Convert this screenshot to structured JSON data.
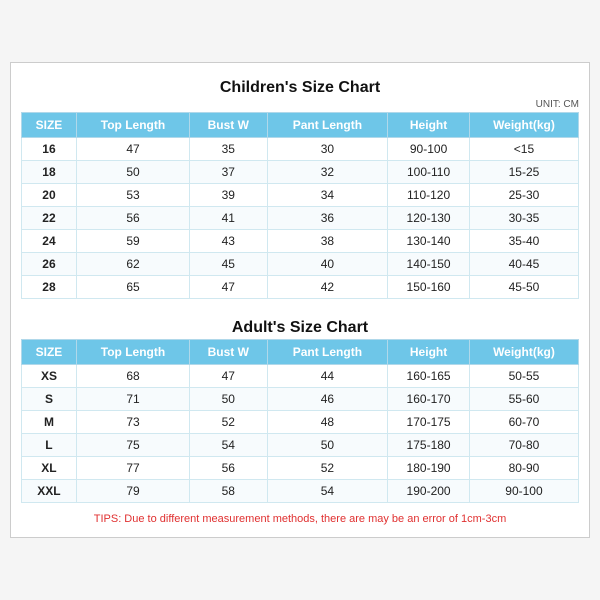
{
  "children_title": "Children's Size Chart",
  "adult_title": "Adult's Size Chart",
  "unit": "UNIT: CM",
  "tips": "TIPS: Due to different measurement methods, there are may be an error of 1cm-3cm",
  "headers": [
    "SIZE",
    "Top Length",
    "Bust W",
    "Pant Length",
    "Height",
    "Weight(kg)"
  ],
  "children_rows": [
    [
      "16",
      "47",
      "35",
      "30",
      "90-100",
      "<15"
    ],
    [
      "18",
      "50",
      "37",
      "32",
      "100-110",
      "15-25"
    ],
    [
      "20",
      "53",
      "39",
      "34",
      "110-120",
      "25-30"
    ],
    [
      "22",
      "56",
      "41",
      "36",
      "120-130",
      "30-35"
    ],
    [
      "24",
      "59",
      "43",
      "38",
      "130-140",
      "35-40"
    ],
    [
      "26",
      "62",
      "45",
      "40",
      "140-150",
      "40-45"
    ],
    [
      "28",
      "65",
      "47",
      "42",
      "150-160",
      "45-50"
    ]
  ],
  "adult_rows": [
    [
      "XS",
      "68",
      "47",
      "44",
      "160-165",
      "50-55"
    ],
    [
      "S",
      "71",
      "50",
      "46",
      "160-170",
      "55-60"
    ],
    [
      "M",
      "73",
      "52",
      "48",
      "170-175",
      "60-70"
    ],
    [
      "L",
      "75",
      "54",
      "50",
      "175-180",
      "70-80"
    ],
    [
      "XL",
      "77",
      "56",
      "52",
      "180-190",
      "80-90"
    ],
    [
      "XXL",
      "79",
      "58",
      "54",
      "190-200",
      "90-100"
    ]
  ]
}
